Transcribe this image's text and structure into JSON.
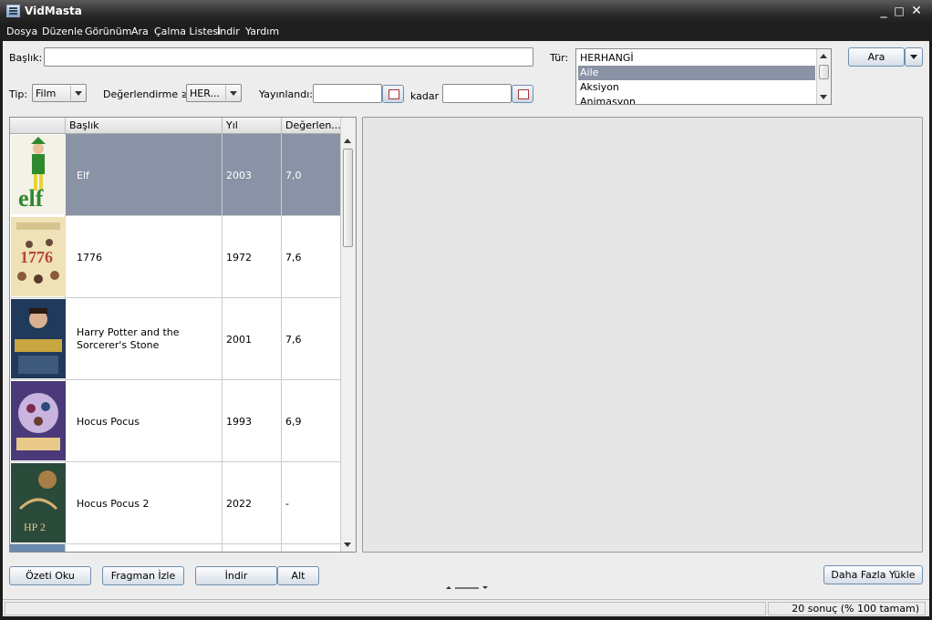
{
  "window": {
    "title": "VidMasta",
    "minimize": "_",
    "maximize": "□",
    "close": "✕"
  },
  "menu": [
    "Dosya",
    "Düzenle",
    "Görünüm",
    "Ara",
    "Çalma Listesi",
    "İndir",
    "Yardım"
  ],
  "search": {
    "title_label": "Başlık:",
    "title_value": "",
    "genre_label": "Tür:",
    "genres": [
      "HERHANGİ",
      "Aile",
      "Aksiyon",
      "Animasyon"
    ],
    "selected_genre": "Aile",
    "search_button": "Ara",
    "type_label": "Tip:",
    "type_value": "Film",
    "rating_label": "Değerlendirme ≥:",
    "rating_value": "HER...",
    "released_label": "Yayınlandı:",
    "from_value": "",
    "until_label": "kadar",
    "until_value": ""
  },
  "table": {
    "columns": [
      "",
      "Başlık",
      "Yıl",
      "Değerlen..."
    ],
    "rows": [
      {
        "title": "Elf",
        "year": "2003",
        "rating": "7,0",
        "selected": true
      },
      {
        "title": "1776",
        "year": "1972",
        "rating": "7,6",
        "selected": false
      },
      {
        "title": "Harry Potter and the Sorcerer's Stone",
        "year": "2001",
        "rating": "7,6",
        "selected": false
      },
      {
        "title": "Hocus Pocus",
        "year": "1993",
        "rating": "6,9",
        "selected": false
      },
      {
        "title": "Hocus Pocus 2",
        "year": "2022",
        "rating": "-",
        "selected": false
      }
    ]
  },
  "buttons": {
    "summary": "Özeti Oku",
    "trailer": "Fragman İzle",
    "download": "İndir",
    "subtitle": "Alt",
    "load_more": "Daha Fazla Yükle"
  },
  "status": {
    "results": "20 sonuç (% 100 tamam)"
  },
  "colors": {
    "selection": "#8a93a5",
    "titlebar": "#2b2b2b",
    "panel": "#ededed"
  }
}
